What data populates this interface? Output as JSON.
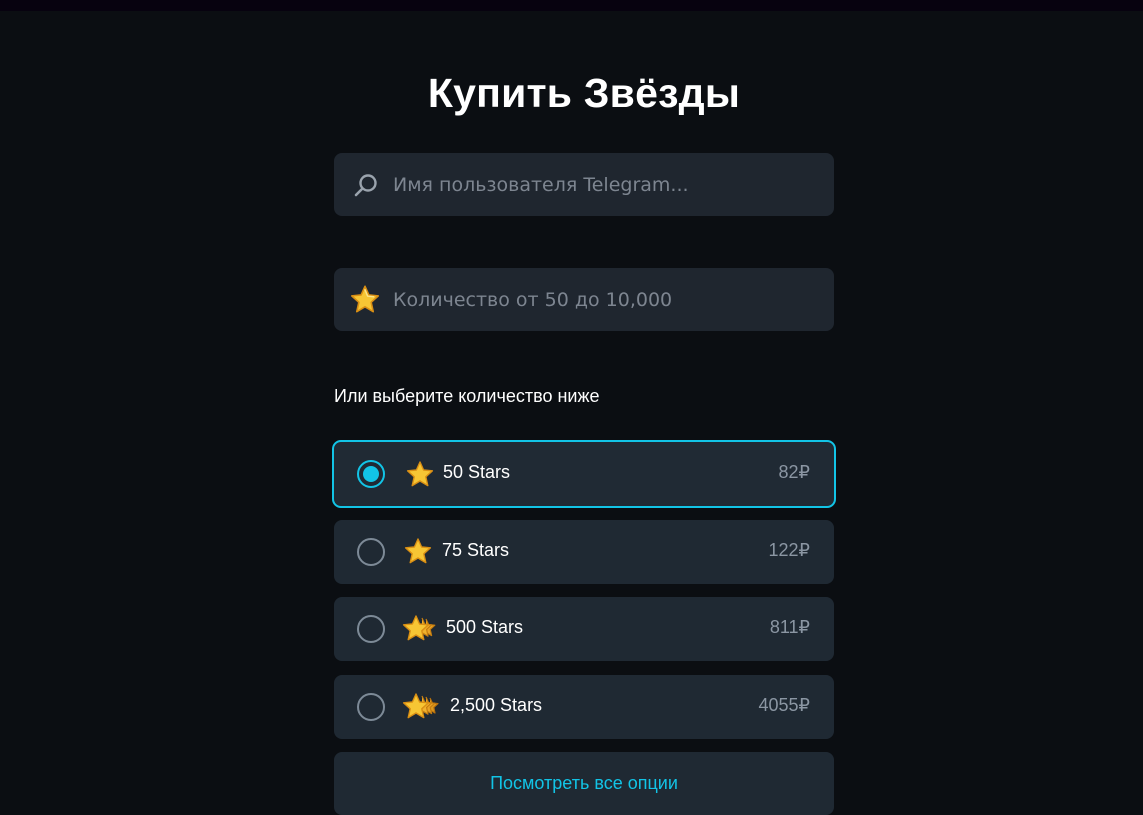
{
  "page": {
    "title": "Купить Звёзды"
  },
  "search": {
    "placeholder": "Имя пользователя Telegram...",
    "value": "",
    "icon": "search-icon"
  },
  "amount": {
    "placeholder": "Количество от 50 до 10,000",
    "value": "",
    "icon": "star-icon"
  },
  "options_label": "Или выберите количество ниже",
  "options": [
    {
      "label": "50 Stars",
      "price": "82₽",
      "selected": true,
      "icon": "star-icon"
    },
    {
      "label": "75 Stars",
      "price": "122₽",
      "selected": false,
      "icon": "star-icon"
    },
    {
      "label": "500 Stars",
      "price": "811₽",
      "selected": false,
      "icon": "stacked-stars-icon"
    },
    {
      "label": "2,500 Stars",
      "price": "4055₽",
      "selected": false,
      "icon": "stacked-stars-icon"
    }
  ],
  "view_all_label": "Посмотреть все опции",
  "colors": {
    "background": "#0b0e12",
    "card": "#1f2933",
    "accent": "#12c4e6",
    "star": "#f5b82e",
    "muted_text": "#8b96a3"
  }
}
